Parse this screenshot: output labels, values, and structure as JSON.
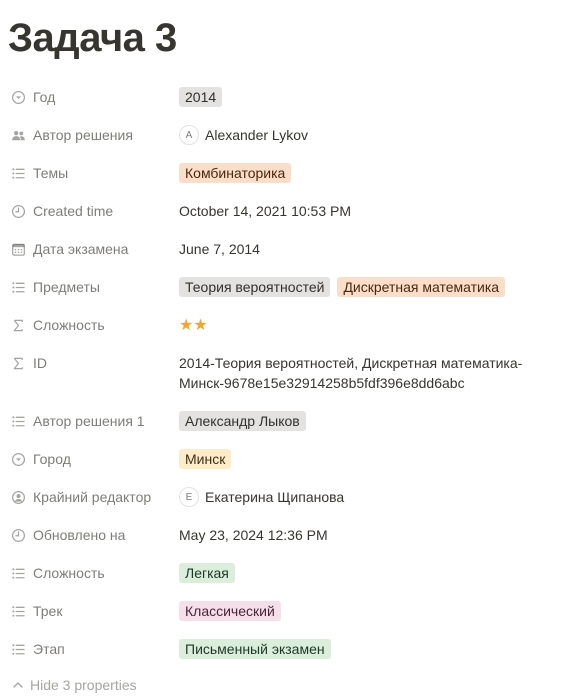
{
  "page": {
    "title": "Задача 3"
  },
  "properties": {
    "year": {
      "label": "Год",
      "icon": "select-icon",
      "value": "2014"
    },
    "solution_author": {
      "label": "Автор решения",
      "icon": "people-icon",
      "avatar": "A",
      "value": "Alexander Lykov"
    },
    "topics": {
      "label": "Темы",
      "icon": "list-icon",
      "tags": [
        "Комбинаторика"
      ]
    },
    "created_time": {
      "label": "Created time",
      "icon": "clock-icon",
      "value": "October 14, 2021 10:53 PM"
    },
    "exam_date": {
      "label": "Дата экзамена",
      "icon": "calendar-icon",
      "value": "June 7, 2014"
    },
    "subjects": {
      "label": "Предметы",
      "icon": "list-icon",
      "tags": [
        "Теория вероятностей",
        "Дискретная математика"
      ]
    },
    "difficulty_formula": {
      "label": "Сложность",
      "icon": "sigma-icon",
      "value": "★★",
      "rating": 2
    },
    "id": {
      "label": "ID",
      "icon": "sigma-icon",
      "line1": "2014-Теория вероятностей, Дискретная математика-",
      "line2": "Минск-9678e15e32914258b5fdf396e8dd6abc"
    },
    "solution_author_1": {
      "label": "Автор решения 1",
      "icon": "list-icon",
      "tags": [
        "Александр Лыков"
      ]
    },
    "city": {
      "label": "Город",
      "icon": "select-icon",
      "value": "Минск"
    },
    "last_editor": {
      "label": "Крайний редактор",
      "icon": "person-circle-icon",
      "avatar": "E",
      "value": "Екатерина Щипанова"
    },
    "updated_at": {
      "label": "Обновлено на",
      "icon": "clock-icon",
      "value": "May 23, 2024 12:36 PM"
    },
    "difficulty": {
      "label": "Сложность",
      "icon": "list-icon",
      "tags": [
        "Легкая"
      ]
    },
    "track": {
      "label": "Трек",
      "icon": "list-icon",
      "tags": [
        "Классический"
      ]
    },
    "stage": {
      "label": "Этап",
      "icon": "list-icon",
      "tags": [
        "Письменный экзамен"
      ]
    }
  },
  "footer": {
    "hide_label": "Hide 3 properties"
  },
  "colors": {
    "tag_gray": "#e3e2e0",
    "tag_orange": "#fadec9",
    "tag_yellow": "#fdecc8",
    "tag_green": "#dbeddb",
    "tag_pink": "#f5e0e9",
    "star": "#f5a623"
  }
}
